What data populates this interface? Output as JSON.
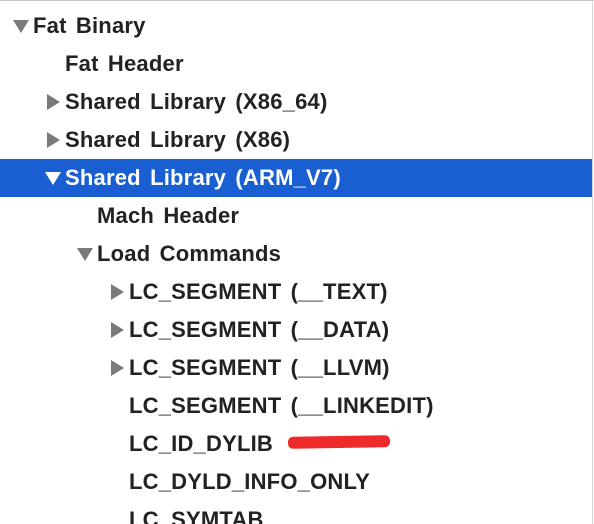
{
  "tree": {
    "rows": [
      {
        "label": "Fat Binary",
        "level": 0,
        "disclosure": "expanded",
        "selected": false
      },
      {
        "label": "Fat Header",
        "level": 1,
        "disclosure": "none",
        "selected": false
      },
      {
        "label": "Shared Library  (X86_64)",
        "level": 1,
        "disclosure": "collapsed",
        "selected": false
      },
      {
        "label": "Shared Library  (X86)",
        "level": 1,
        "disclosure": "collapsed",
        "selected": false
      },
      {
        "label": "Shared Library  (ARM_V7)",
        "level": 1,
        "disclosure": "expanded",
        "selected": true
      },
      {
        "label": "Mach Header",
        "level": 2,
        "disclosure": "none",
        "selected": false
      },
      {
        "label": "Load Commands",
        "level": 2,
        "disclosure": "expanded",
        "selected": false
      },
      {
        "label": "LC_SEGMENT (__TEXT)",
        "level": 3,
        "disclosure": "collapsed",
        "selected": false
      },
      {
        "label": "LC_SEGMENT (__DATA)",
        "level": 3,
        "disclosure": "collapsed",
        "selected": false
      },
      {
        "label": "LC_SEGMENT (__LLVM)",
        "level": 3,
        "disclosure": "collapsed",
        "selected": false
      },
      {
        "label": "LC_SEGMENT (__LINKEDIT)",
        "level": 3,
        "disclosure": "none",
        "selected": false
      },
      {
        "label": "LC_ID_DYLIB",
        "level": 3,
        "disclosure": "none",
        "selected": false,
        "redacted": true
      },
      {
        "label": "LC_DYLD_INFO_ONLY",
        "level": 3,
        "disclosure": "none",
        "selected": false
      },
      {
        "label": "LC_SYMTAB",
        "level": 3,
        "disclosure": "none",
        "selected": false
      }
    ],
    "colors": {
      "selection": "#1a5fd2",
      "text": "#222222",
      "selected_text": "#ffffff",
      "disclosure_triangle": "#7a7a7a",
      "redaction_mark": "#ee2a2a"
    }
  }
}
